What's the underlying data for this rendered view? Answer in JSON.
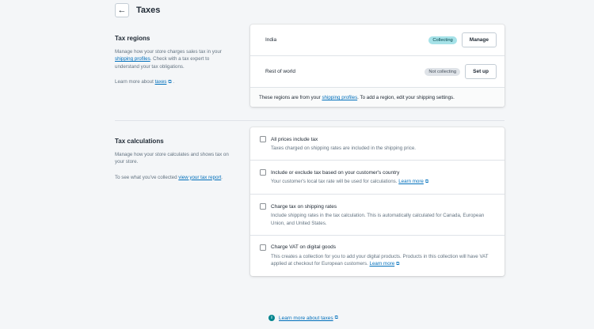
{
  "header": {
    "back_icon": "←",
    "title": "Taxes"
  },
  "tax_regions": {
    "title": "Tax regions",
    "desc_prefix": "Manage how your store charges sales tax in your ",
    "desc_link": "shipping profiles",
    "desc_suffix": ". Check with a tax expert to understand your tax obligations.",
    "learn_prefix": "Learn more about ",
    "learn_link": "taxes",
    "learn_suffix": " .",
    "regions": [
      {
        "name": "India",
        "status": "Collecting",
        "button": "Manage"
      },
      {
        "name": "Rest of world",
        "status": "Not collecting",
        "button": "Set up"
      }
    ],
    "footer_prefix": "These regions are from your ",
    "footer_link": "shipping profiles",
    "footer_suffix": ". To add a region, edit your shipping settings."
  },
  "tax_calculations": {
    "title": "Tax calculations",
    "desc": "Manage how your store calculates and shows tax on your store.",
    "report_prefix": "To see what you've collected ",
    "report_link": "view your tax report",
    "report_suffix": ".",
    "options": [
      {
        "label": "All prices include tax",
        "desc": "Taxes charged on shipping rates are included in the shipping price.",
        "link": ""
      },
      {
        "label": "Include or exclude tax based on your customer's country",
        "desc": "Your customer's local tax rate will be used for calculations. ",
        "link": "Learn more"
      },
      {
        "label": "Charge tax on shipping rates",
        "desc": "Include shipping rates in the tax calculation. This is automatically calculated for Canada, European Union, and United States.",
        "link": ""
      },
      {
        "label": "Charge VAT on digital goods",
        "desc": "This creates a collection for you to add your digital products. Products in this collection will have VAT applied at checkout for European customers. ",
        "link": "Learn more"
      }
    ]
  },
  "bottom": {
    "info_icon": "i",
    "link": "Learn more about taxes"
  }
}
